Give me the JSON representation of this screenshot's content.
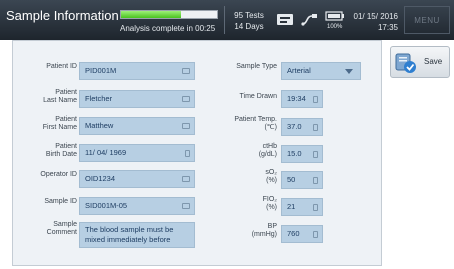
{
  "header": {
    "title": "Sample Information",
    "status": "Analysis complete in 00:25",
    "progress": 0.62,
    "tests": "95 Tests",
    "days": "14 Days",
    "battery_pct": "100%",
    "date": "01/ 15/ 2016",
    "time": "17:35",
    "menu_label": "MENU"
  },
  "form": {
    "patient_id": {
      "label": "Patient ID",
      "value": "PID001M"
    },
    "last_name": {
      "label1": "Patient",
      "label2": "Last Name",
      "value": "Fletcher"
    },
    "first_name": {
      "label1": "Patient",
      "label2": "First Name",
      "value": "Matthew"
    },
    "birth_date": {
      "label1": "Patient",
      "label2": "Birth Date",
      "value": "11/ 04/ 1969"
    },
    "operator_id": {
      "label": "Operator ID",
      "value": "OID1234"
    },
    "sample_id": {
      "label": "Sample ID",
      "value": "SID001M-05"
    },
    "comment": {
      "label1": "Sample",
      "label2": "Comment",
      "value": "The blood sample must be mixed immediately before"
    },
    "sample_type": {
      "label": "Sample Type",
      "value": "Arterial"
    },
    "time_drawn": {
      "label": "Time Drawn",
      "value": "19:34"
    },
    "patient_temp": {
      "label1": "Patient Temp.",
      "label2": "(℃)",
      "value": "37.0"
    },
    "cthb": {
      "label1": "ctHb",
      "label2": "(g/dL)",
      "value": "15.0"
    },
    "so2": {
      "label1": "sO₂",
      "label2": "(%)",
      "value": "50"
    },
    "fio2": {
      "label1": "FIO₂",
      "label2": "(%)",
      "value": "21"
    },
    "bp": {
      "label1": "BP",
      "label2": "(mmHg)",
      "value": "760"
    }
  },
  "sidebar": {
    "save_label": "Save",
    "save_icon": "save-check-icon"
  }
}
